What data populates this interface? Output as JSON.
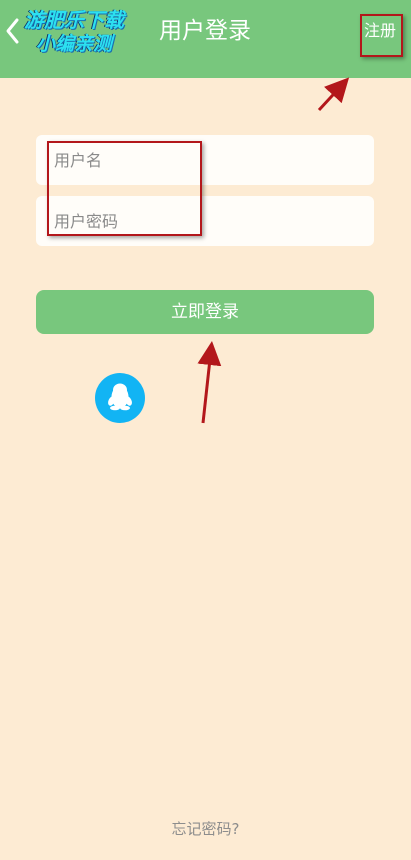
{
  "header": {
    "back_icon": "chevron-left-icon",
    "watermark_line1": "游肥乐下载",
    "watermark_line2": "小编亲测",
    "title": "用户登录",
    "register_label": "注册"
  },
  "form": {
    "username_placeholder": "用户名",
    "username_value": "",
    "password_placeholder": "用户密码",
    "password_value": "",
    "login_label": "立即登录"
  },
  "social": {
    "qq_icon": "qq-penguin-icon"
  },
  "footer": {
    "forgot_password_label": "忘记密码?"
  },
  "colors": {
    "topbar": "#78c77d",
    "background": "#fdebd3",
    "login_button": "#78c77d",
    "qq_button": "#12b4f4",
    "annotation": "#b3171b"
  }
}
